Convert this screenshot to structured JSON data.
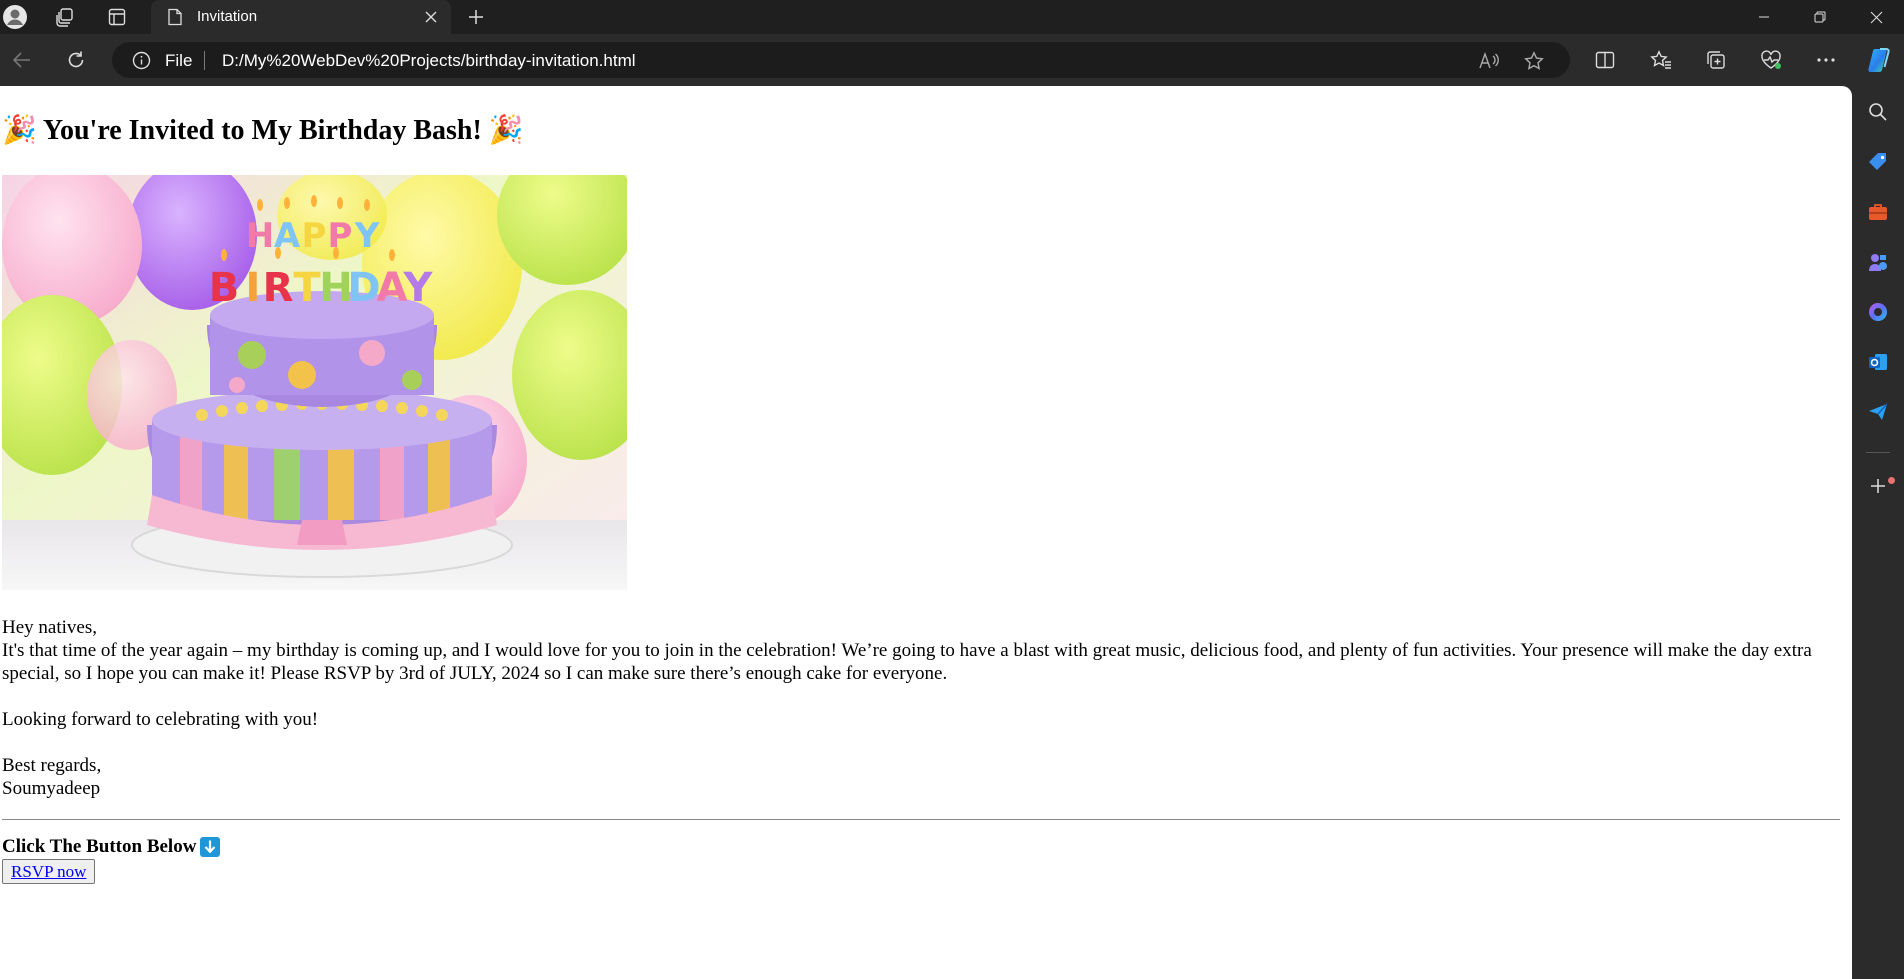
{
  "browser": {
    "tab": {
      "title": "Invitation"
    },
    "address": {
      "scheme": "File",
      "url": "D:/My%20WebDev%20Projects/birthday-invitation.html"
    },
    "read_aloud_label": "A̅"
  },
  "page": {
    "heading": {
      "left_emoji": "🎉",
      "text": "You're Invited to My Birthday Bash!",
      "right_emoji": "🎉"
    },
    "image": {
      "letters": "HAPPY BIRTHDAY"
    },
    "greeting": "Hey natives,",
    "body": "It's that time of the year again – my birthday is coming up, and I would love for you to join in the celebration! We’re going to have a blast with great music, delicious food, and plenty of fun activities. Your presence will make the day extra special, so I hope you can make it! Please RSVP by 3rd of JULY, 2024 so I can make sure there’s enough cake for everyone.",
    "closing": "Looking forward to celebrating with you!",
    "signoff": "Best regards,",
    "signature": "Soumyadeep",
    "cta_label": "Click The Button Below",
    "cta_icon": "⬇",
    "rsvp_button": "RSVP now"
  },
  "colors": {
    "tabstrip_bg": "#1f1f1f",
    "toolbar_bg": "#2b2b2b",
    "page_bg": "#ffffff",
    "link": "#0000ee",
    "arrow_badge": "#1e96d8"
  },
  "icons": {
    "tabstrip": [
      "profile-avatar-icon",
      "workspaces-icon",
      "tab-actions-icon",
      "page-icon",
      "close-icon",
      "plus-icon",
      "minimize-icon",
      "restore-icon",
      "window-close-icon"
    ],
    "toolbar": [
      "back-arrow-icon",
      "refresh-icon",
      "info-icon",
      "read-aloud-icon",
      "star-icon",
      "split-screen-icon",
      "favorites-icon",
      "collections-icon",
      "browser-essentials-icon",
      "more-icon",
      "copilot-icon"
    ],
    "sidebar": [
      "search-icon",
      "shopping-tag-icon",
      "tools-icon",
      "games-icon",
      "microsoft-365-icon",
      "outlook-icon",
      "send-icon",
      "add-icon"
    ]
  }
}
